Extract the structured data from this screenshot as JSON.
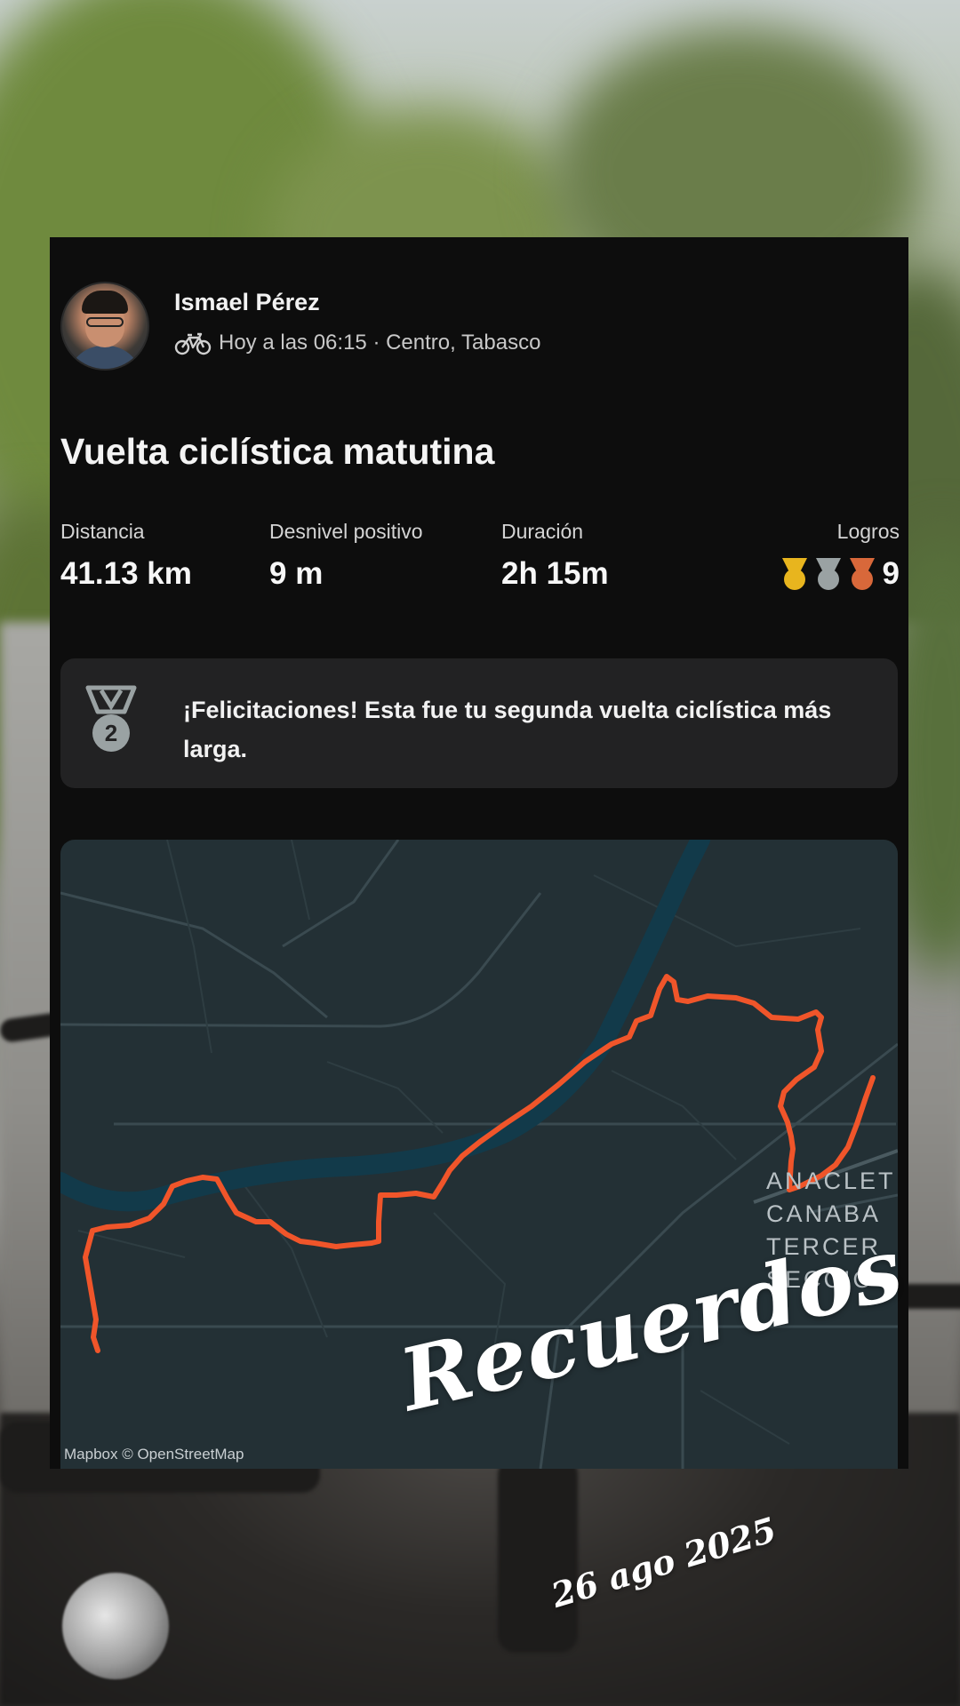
{
  "user": {
    "name": "Ismael Pérez",
    "activity_icon": "bicycle-icon",
    "meta": "Hoy a las 06:15 · Centro, Tabasco"
  },
  "activity": {
    "title": "Vuelta ciclística matutina"
  },
  "stats": {
    "distance": {
      "label": "Distancia",
      "value": "41.13 km"
    },
    "elevation": {
      "label": "Desnivel positivo",
      "value": "9 m"
    },
    "duration": {
      "label": "Duración",
      "value": "2h 15m"
    },
    "achievements": {
      "label": "Logros",
      "count": "9",
      "medals": [
        "gold-medal-icon",
        "silver-medal-icon",
        "bronze-medal-icon"
      ]
    }
  },
  "congrats": {
    "icon": "second-place-medal-icon",
    "message": "¡Felicitaciones! Esta fue tu segunda vuelta ciclística más larga."
  },
  "map": {
    "attribution": "Mapbox © OpenStreetMap",
    "place_label": [
      "ANACLET",
      "CANABA",
      "TERCER",
      "SECCIÓ"
    ],
    "route_color": "#f0552a"
  },
  "overlay": {
    "caption": "Recuerdos",
    "date": "26 ago 2025"
  },
  "colors": {
    "card": "#0d0d0d",
    "panel": "#222223",
    "map_bg": "#233035",
    "river": "#123a4a",
    "gold": "#e8b51e",
    "silver": "#9aa2a3",
    "bronze": "#d8683a"
  }
}
